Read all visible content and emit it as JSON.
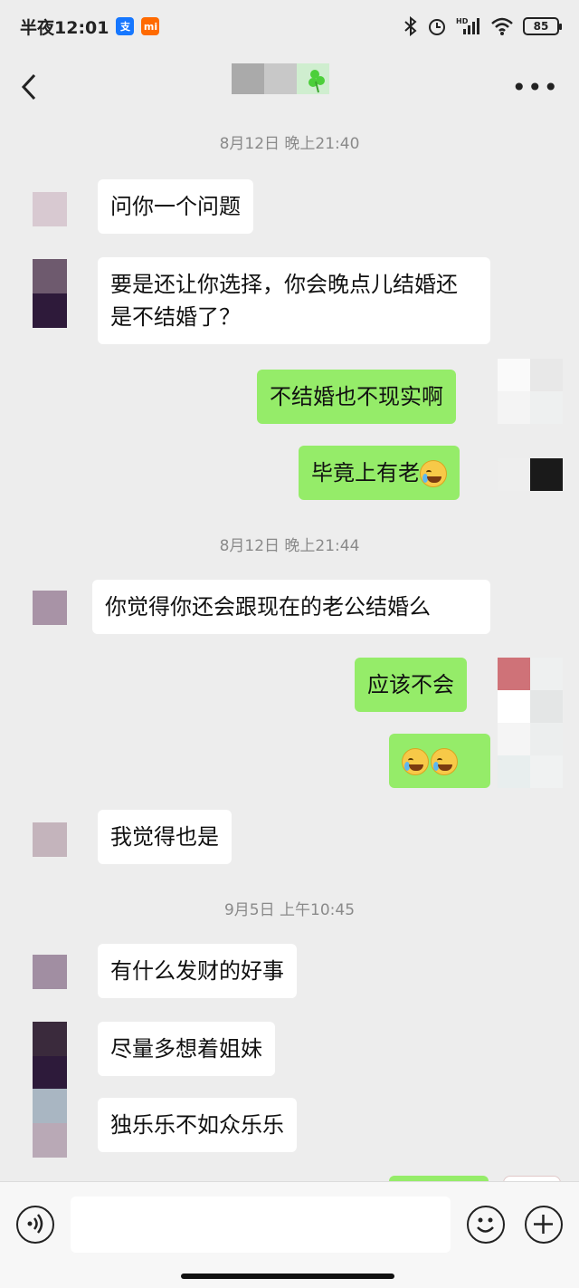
{
  "status_bar": {
    "time": "半夜12:01",
    "battery": "85",
    "hd_label": "HD"
  },
  "header": {
    "title_accent_icon": "shamrock-icon",
    "more_label": "•••"
  },
  "timestamps": [
    "8月12日 晚上21:40",
    "8月12日 晚上21:44",
    "9月5日 上午10:45"
  ],
  "messages": [
    {
      "side": "in",
      "text": "问你一个问题"
    },
    {
      "side": "in",
      "text": "要是还让你选择，你会晚点儿结婚还是不结婚了？"
    },
    {
      "side": "out",
      "text": "不结婚也不现实啊"
    },
    {
      "side": "out",
      "text": "毕竟上有老",
      "emoji": "laugh-cry"
    },
    {
      "side": "in",
      "text": "你觉得你还会跟现在的老公结婚么"
    },
    {
      "side": "out",
      "text": "应该不会"
    },
    {
      "side": "out",
      "text": "",
      "emoji": "laugh-cry x2"
    },
    {
      "side": "in",
      "text": "我觉得也是"
    },
    {
      "side": "in",
      "text": "有什么发财的好事"
    },
    {
      "side": "in",
      "text": "尽量多想着姐妹"
    },
    {
      "side": "in",
      "text": "独乐乐不如众乐乐"
    }
  ],
  "colors": {
    "outgoing_bubble": "#95ec69",
    "incoming_bubble": "#ffffff",
    "background": "#ededed"
  }
}
